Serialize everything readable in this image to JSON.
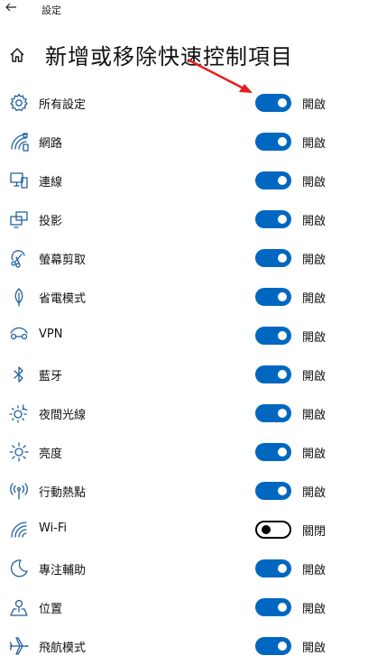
{
  "window": {
    "title": "設定",
    "back_icon": "back-arrow-icon"
  },
  "header": {
    "home_icon": "home-icon",
    "title": "新增或移除快速控制項目"
  },
  "annotation": {
    "color": "#e81c1c",
    "icon": "red-arrow-annotation"
  },
  "colors": {
    "toggle_on": "#0067c0",
    "toggle_off_border": "#000000"
  },
  "items": [
    {
      "label": "所有設定",
      "icon": "gear-icon",
      "on": true,
      "state": "開啟"
    },
    {
      "label": "網路",
      "icon": "network-icon",
      "on": true,
      "state": "開啟"
    },
    {
      "label": "連線",
      "icon": "connect-icon",
      "on": true,
      "state": "開啟"
    },
    {
      "label": "投影",
      "icon": "project-icon",
      "on": true,
      "state": "開啟"
    },
    {
      "label": "螢幕剪取",
      "icon": "screen-snip-icon",
      "on": true,
      "state": "開啟"
    },
    {
      "label": "省電模式",
      "icon": "battery-saver-icon",
      "on": true,
      "state": "開啟"
    },
    {
      "label": "VPN",
      "icon": "vpn-icon",
      "on": true,
      "state": "開啟"
    },
    {
      "label": "藍牙",
      "icon": "bluetooth-icon",
      "on": true,
      "state": "開啟"
    },
    {
      "label": "夜間光線",
      "icon": "night-light-icon",
      "on": true,
      "state": "開啟"
    },
    {
      "label": "亮度",
      "icon": "brightness-icon",
      "on": true,
      "state": "開啟"
    },
    {
      "label": "行動熱點",
      "icon": "mobile-hotspot-icon",
      "on": true,
      "state": "開啟"
    },
    {
      "label": "Wi-Fi",
      "icon": "wifi-icon",
      "on": false,
      "state": "關閉"
    },
    {
      "label": "專注輔助",
      "icon": "focus-assist-icon",
      "on": true,
      "state": "開啟"
    },
    {
      "label": "位置",
      "icon": "location-icon",
      "on": true,
      "state": "開啟"
    },
    {
      "label": "飛航模式",
      "icon": "airplane-mode-icon",
      "on": true,
      "state": "開啟"
    }
  ]
}
